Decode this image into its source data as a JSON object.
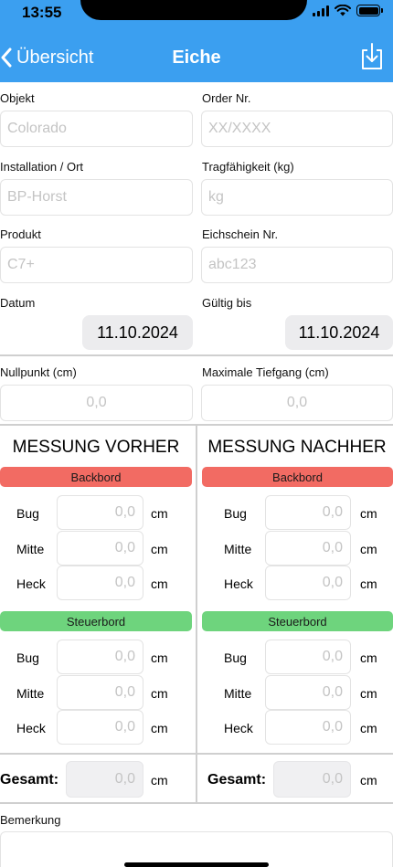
{
  "status": {
    "time": "13:55"
  },
  "nav": {
    "back_label": "Übersicht",
    "title": "Eiche",
    "download_icon": "download-icon"
  },
  "form": {
    "objekt": {
      "label": "Objekt",
      "placeholder": "Colorado"
    },
    "order_nr": {
      "label": "Order Nr.",
      "placeholder": "XX/XXXX"
    },
    "installation": {
      "label": "Installation / Ort",
      "placeholder": "BP-Horst"
    },
    "tragfaehigkeit": {
      "label": "Tragfähigkeit (kg)",
      "placeholder": "kg"
    },
    "produkt": {
      "label": "Produkt",
      "placeholder": "C7+"
    },
    "eichschein": {
      "label": "Eichschein Nr.",
      "placeholder": "abc123"
    },
    "datum": {
      "label": "Datum",
      "value": "11.10.2024"
    },
    "gueltig_bis": {
      "label": "Gültig bis",
      "value": "11.10.2024"
    },
    "nullpunkt": {
      "label": "Nullpunkt (cm)",
      "placeholder": "0,0"
    },
    "max_tiefgang": {
      "label": "Maximale Tiefgang (cm)",
      "placeholder": "0,0"
    }
  },
  "vorher": {
    "title": "MESSUNG VORHER",
    "backbord": {
      "label": "Backbord",
      "rows": [
        {
          "label": "Bug",
          "value": "0,0",
          "unit": "cm"
        },
        {
          "label": "Mitte",
          "value": "0,0",
          "unit": "cm"
        },
        {
          "label": "Heck",
          "value": "0,0",
          "unit": "cm"
        }
      ]
    },
    "steuerbord": {
      "label": "Steuerbord",
      "rows": [
        {
          "label": "Bug",
          "value": "0,0",
          "unit": "cm"
        },
        {
          "label": "Mitte",
          "value": "0,0",
          "unit": "cm"
        },
        {
          "label": "Heck",
          "value": "0,0",
          "unit": "cm"
        }
      ]
    },
    "gesamt": {
      "label": "Gesamt:",
      "value": "0,0",
      "unit": "cm"
    }
  },
  "nachher": {
    "title": "MESSUNG NACHHER",
    "backbord": {
      "label": "Backbord",
      "rows": [
        {
          "label": "Bug",
          "value": "0,0",
          "unit": "cm"
        },
        {
          "label": "Mitte",
          "value": "0,0",
          "unit": "cm"
        },
        {
          "label": "Heck",
          "value": "0,0",
          "unit": "cm"
        }
      ]
    },
    "steuerbord": {
      "label": "Steuerbord",
      "rows": [
        {
          "label": "Bug",
          "value": "0,0",
          "unit": "cm"
        },
        {
          "label": "Mitte",
          "value": "0,0",
          "unit": "cm"
        },
        {
          "label": "Heck",
          "value": "0,0",
          "unit": "cm"
        }
      ]
    },
    "gesamt": {
      "label": "Gesamt:",
      "value": "0,0",
      "unit": "cm"
    }
  },
  "bemerkung": {
    "label": "Bemerkung"
  },
  "colors": {
    "header": "#3b9ff0",
    "backbord": "#f26b63",
    "steuerbord": "#6ed47d"
  }
}
